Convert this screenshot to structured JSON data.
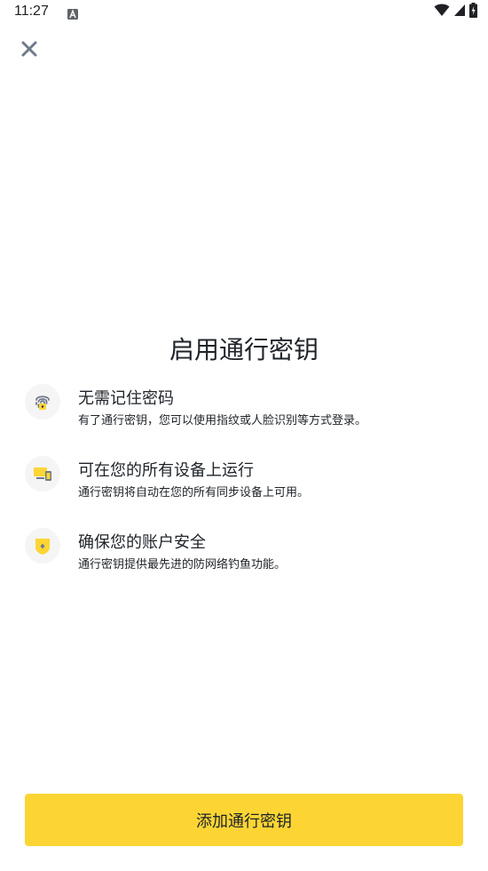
{
  "status_bar": {
    "time": "11:27",
    "icons": [
      "a-notification-icon",
      "wifi-icon",
      "signal-icon",
      "battery-charging-icon"
    ]
  },
  "header": {
    "close_icon": "close-icon"
  },
  "main": {
    "title": "启用通行密钥",
    "features": [
      {
        "icon": "fingerprint-icon",
        "title": "无需记住密码",
        "description": "有了通行密钥，您可以使用指纹或人脸识别等方式登录。"
      },
      {
        "icon": "devices-icon",
        "title": "可在您的所有设备上运行",
        "description": "通行密钥将自动在您的所有同步设备上可用。"
      },
      {
        "icon": "shield-icon",
        "title": "确保您的账户安全",
        "description": "通行密钥提供最先进的防网络钓鱼功能。"
      }
    ]
  },
  "footer": {
    "add_button_label": "添加通行密钥"
  },
  "colors": {
    "accent": "#fcd535",
    "icon_gray": "#707a8a",
    "text": "#1e2329",
    "icon_bg": "#f5f5f5"
  }
}
